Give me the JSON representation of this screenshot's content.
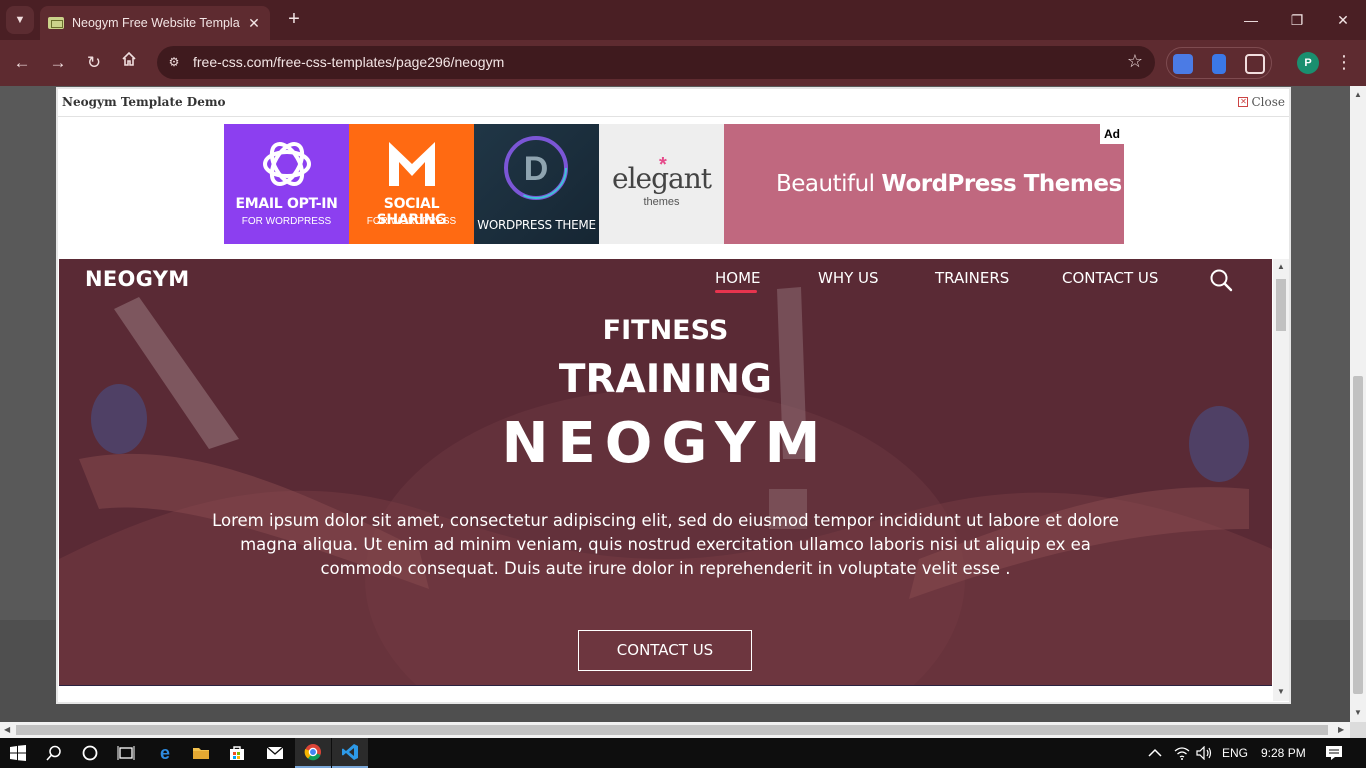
{
  "browser": {
    "tab_title": "Neogym Free Website Template",
    "url": "free-css.com/free-css-templates/page296/neogym",
    "profile_initial": "P"
  },
  "modal": {
    "title": "Neogym Template Demo",
    "close_label": "Close"
  },
  "ad": {
    "label": "Ad",
    "cells": [
      {
        "line1": "EMAIL OPT-IN",
        "line2": "FOR WORDPRESS",
        "color": "#8c3ff0"
      },
      {
        "line1": "SOCIAL SHARING",
        "line2": "FOR WORDPRESS",
        "color": "#ff6a12"
      },
      {
        "line1": "WORDPRESS THEME",
        "line2": "",
        "color": "#1f3242"
      },
      {
        "line1": "elegant",
        "line2": "themes",
        "color": "#f2f2f2"
      }
    ],
    "tagline_light": "Beautiful",
    "tagline_bold": "WordPress Themes",
    "bg_color": "#c0687f"
  },
  "site": {
    "logo": "NEOGYM",
    "nav": [
      "HOME",
      "WHY US",
      "TRAINERS",
      "CONTACT US"
    ],
    "active_nav": "HOME",
    "heading_1": "FITNESS",
    "heading_2": "TRAINING",
    "heading_3": "NEOGYM",
    "paragraph": "Lorem ipsum dolor sit amet, consectetur adipiscing elit, sed do eiusmod tempor incididunt ut labore et dolore magna aliqua. Ut enim ad minim veniam, quis nostrud exercitation ullamco laboris nisi ut aliquip ex ea commodo consequat. Duis aute irure dolor in reprehenderit in voluptate velit esse .",
    "cta_label": "CONTACT US",
    "hero_color": "#5a2a35",
    "accent_color": "#e8344e"
  },
  "taskbar": {
    "language": "ENG",
    "time": "9:28 PM"
  }
}
